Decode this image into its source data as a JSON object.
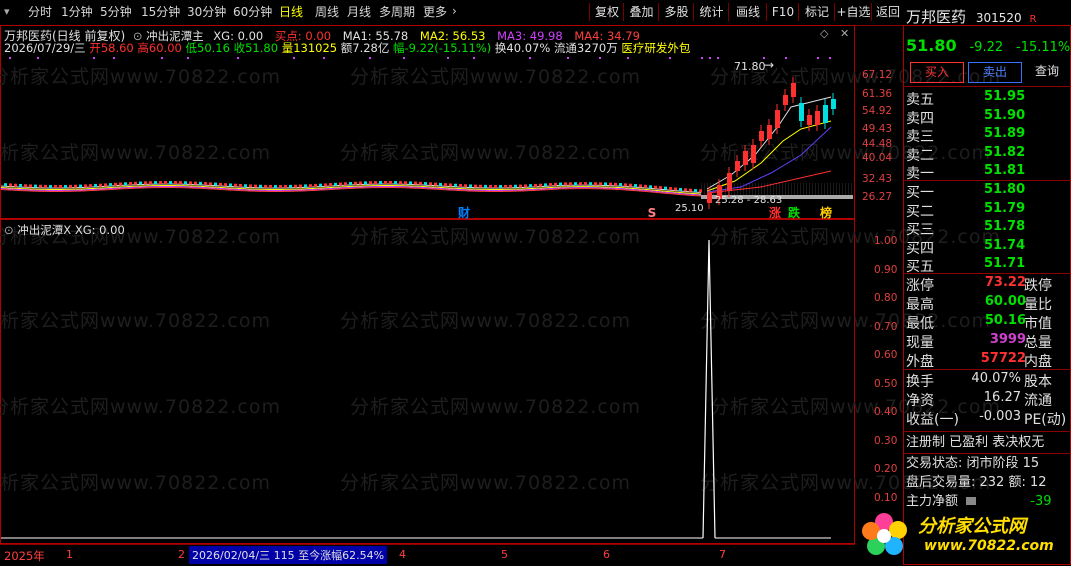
{
  "toolbar": {
    "periods": [
      "分时",
      "1分钟",
      "5分钟",
      "15分钟",
      "30分钟",
      "60分钟",
      "日线",
      "周线",
      "月线",
      "多周期",
      "更多"
    ],
    "active_period": "日线",
    "actions": [
      "复权",
      "叠加",
      "多股",
      "统计",
      "画线",
      "F10",
      "标记",
      "+自选",
      "返回"
    ]
  },
  "stock": {
    "name": "万邦医药",
    "code": "301520",
    "market_tag": "R",
    "price": "51.80",
    "change": "-9.22",
    "change_pct": "-15.11%"
  },
  "chart_header": {
    "title": "万邦医药(日线 前复权)",
    "indicator_name": "冲出泥潭主",
    "xg": "XG: 0.00",
    "buy_point": "买点: 0.00",
    "ma1": "MA1: 55.78",
    "ma2": "MA2: 56.53",
    "ma3": "MA3: 49.98",
    "ma4": "MA4: 34.79"
  },
  "day_info": {
    "date": "2026/07/29/三",
    "open": "开58.60",
    "high": "高60.00",
    "low": "低50.16",
    "close": "收51.80",
    "volume": "量131025",
    "amount": "额7.28亿",
    "amplitude": "幅-9.22(-15.11%)",
    "turnover": "换40.07%",
    "float": "流通3270万",
    "sector": "医疗研发外包"
  },
  "main_chart": {
    "y_ticks": [
      "67.12",
      "61.36",
      "54.92",
      "49.43",
      "44.48",
      "40.04",
      "32.43",
      "26.27"
    ],
    "annotations": {
      "peak": "71.80",
      "range": "25.28 - 28.63",
      "low_mark": "25.10"
    },
    "badges": [
      "财",
      "S",
      "涨",
      "跌",
      "榜"
    ]
  },
  "sub_chart": {
    "title": "冲出泥潭X XG: 0.00",
    "y_ticks": [
      "1.00",
      "0.90",
      "0.80",
      "0.70",
      "0.60",
      "0.50",
      "0.40",
      "0.30",
      "0.20",
      "0.10",
      "0"
    ],
    "chart_data": {
      "type": "line",
      "series": [
        {
          "name": "XG",
          "values": [
            0,
            0,
            0,
            0,
            0,
            0,
            0,
            0,
            0,
            0,
            0,
            0,
            0,
            0,
            0,
            0,
            0,
            0,
            0,
            0,
            0,
            0,
            0,
            0,
            0,
            0,
            0,
            0,
            0,
            0,
            0,
            0,
            0,
            0,
            0,
            0,
            0,
            0,
            0,
            0,
            0,
            0,
            0,
            0,
            0,
            0,
            0,
            0,
            0,
            0,
            0,
            0,
            0,
            0,
            0,
            0,
            0,
            0,
            0,
            0,
            0,
            0,
            0,
            0,
            0,
            0,
            0,
            0,
            0,
            0,
            0,
            0,
            0,
            0,
            0,
            0,
            0,
            0,
            0,
            1,
            0,
            0,
            0,
            0,
            0,
            0,
            0,
            0,
            0,
            0,
            0,
            0,
            0,
            0,
            0,
            0,
            0,
            0,
            0,
            0,
            0,
            0,
            0,
            0,
            0,
            0,
            0,
            0,
            0,
            0,
            0,
            0,
            0,
            0,
            0,
            0,
            0,
            0,
            0,
            0
          ]
        }
      ],
      "ylim": [
        0,
        1
      ]
    }
  },
  "timeline": {
    "year": "2025年",
    "months": [
      "1",
      "2",
      "3",
      "4",
      "5",
      "6",
      "7"
    ],
    "selected": "2026/02/04/三 115 至今涨幅62.54%"
  },
  "order_book": {
    "asks": [
      {
        "label": "卖五",
        "price": "51.95"
      },
      {
        "label": "卖四",
        "price": "51.90"
      },
      {
        "label": "卖三",
        "price": "51.89"
      },
      {
        "label": "卖二",
        "price": "51.82"
      },
      {
        "label": "卖一",
        "price": "51.81"
      }
    ],
    "bids": [
      {
        "label": "买一",
        "price": "51.80"
      },
      {
        "label": "买二",
        "price": "51.79"
      },
      {
        "label": "买三",
        "price": "51.78"
      },
      {
        "label": "买四",
        "price": "51.74"
      },
      {
        "label": "买五",
        "price": "51.71"
      }
    ]
  },
  "trade_buttons": {
    "buy": "买入",
    "sell": "卖出",
    "query": "查询"
  },
  "stats": [
    {
      "label": "涨停",
      "value": "73.22",
      "label2": "跌停",
      "color": "#ff3030"
    },
    {
      "label": "最高",
      "value": "60.00",
      "label2": "量比",
      "color": "#00e000"
    },
    {
      "label": "最低",
      "value": "50.16",
      "label2": "市值",
      "color": "#00e000"
    },
    {
      "label": "现量",
      "value": "3999",
      "label2": "总量",
      "color": "#d040d0"
    },
    {
      "label": "外盘",
      "value": "57722",
      "label2": "内盘",
      "color": "#ff3030"
    }
  ],
  "stats2": [
    {
      "label": "换手",
      "value": "40.07%",
      "label2": "股本"
    },
    {
      "label": "净资",
      "value": "16.27",
      "label2": "流通"
    },
    {
      "label": "收益(一)",
      "value": "-0.003",
      "label2": "PE(动)"
    }
  ],
  "tags": "注册制 已盈利 表决权无",
  "extra": {
    "status": "交易状态: 闭市阶段 15",
    "after_hours": "盘后交易量: 232  额: 12",
    "main_flow_label": "主力净额",
    "main_flow_value": "-39"
  },
  "watermark": {
    "site": "www.70822.com",
    "brand": "分析家公式网",
    "logo_title": "分析家公式网",
    "logo_url": "www.70822.com"
  },
  "colors": {
    "up": "#ff3030",
    "down": "#00e000",
    "frame": "#b00000",
    "highlight": "#ffff00"
  }
}
